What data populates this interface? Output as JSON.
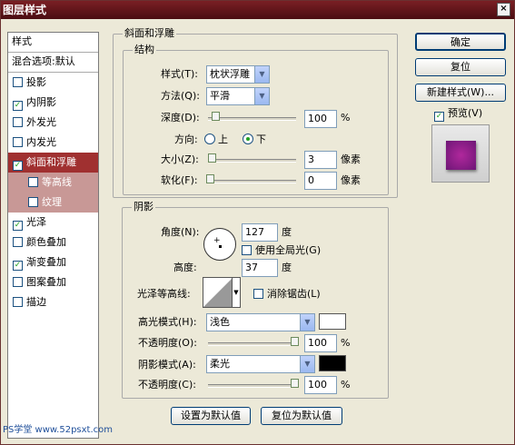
{
  "window": {
    "title": "图层样式",
    "close": "×"
  },
  "styles": {
    "header": "样式",
    "blending": "混合选项:默认",
    "items": [
      {
        "label": "投影",
        "checked": ""
      },
      {
        "label": "内阴影",
        "checked": "✓"
      },
      {
        "label": "外发光",
        "checked": ""
      },
      {
        "label": "内发光",
        "checked": ""
      },
      {
        "label": "斜面和浮雕",
        "checked": "✓"
      },
      {
        "label": "等高线",
        "checked": ""
      },
      {
        "label": "纹理",
        "checked": ""
      },
      {
        "label": "光泽",
        "checked": "✓"
      },
      {
        "label": "颜色叠加",
        "checked": ""
      },
      {
        "label": "渐变叠加",
        "checked": "✓"
      },
      {
        "label": "图案叠加",
        "checked": ""
      },
      {
        "label": "描边",
        "checked": ""
      }
    ]
  },
  "bevel": {
    "title": "斜面和浮雕",
    "structure": "结构",
    "style_label": "样式(T):",
    "style_value": "枕状浮雕",
    "technique_label": "方法(Q):",
    "technique_value": "平滑",
    "depth_label": "深度(D):",
    "depth_value": "100",
    "depth_unit": "%",
    "direction_label": "方向:",
    "dir_up": "上",
    "dir_down": "下",
    "size_label": "大小(Z):",
    "size_value": "3",
    "size_unit": "像素",
    "soften_label": "软化(F):",
    "soften_value": "0",
    "soften_unit": "像素"
  },
  "shading": {
    "title": "阴影",
    "angle_label": "角度(N):",
    "angle_value": "127",
    "angle_unit": "度",
    "global_light": "使用全局光(G)",
    "altitude_label": "高度:",
    "altitude_value": "37",
    "altitude_unit": "度",
    "gloss_label": "光泽等高线:",
    "anti_alias": "消除锯齿(L)",
    "highlight_label": "高光模式(H):",
    "highlight_value": "浅色",
    "opacity1_label": "不透明度(O):",
    "opacity1_value": "100",
    "opacity1_unit": "%",
    "shadow_label": "阴影模式(A):",
    "shadow_value": "柔光",
    "opacity2_label": "不透明度(C):",
    "opacity2_value": "100",
    "opacity2_unit": "%"
  },
  "defaults": {
    "make": "设置为默认值",
    "reset": "复位为默认值"
  },
  "buttons": {
    "ok": "确定",
    "reset": "复位",
    "new_style": "新建样式(W)...",
    "preview": "预览(V)"
  },
  "watermark": "PS学堂 www.52psxt.com",
  "colors": {
    "title": "#5b1218",
    "selected": "#a03030",
    "preview": "#8b1a8b",
    "highlight": "#ffffff",
    "shadow": "#000000"
  }
}
